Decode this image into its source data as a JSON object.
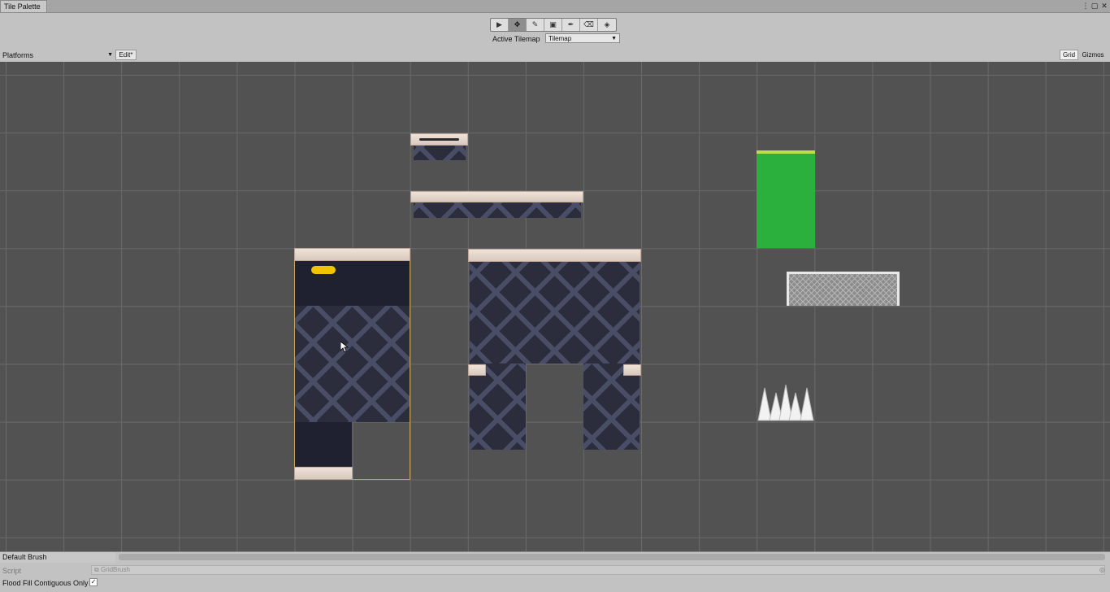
{
  "window": {
    "tab_title": "Tile Palette",
    "menu_icon": "kebab-icon",
    "maximize_icon": "maximize-icon",
    "close_icon": "close-icon"
  },
  "toolbar": {
    "tools": [
      {
        "name": "select-tool",
        "icon": "▶",
        "active": false
      },
      {
        "name": "move-tool",
        "icon": "✥",
        "active": true
      },
      {
        "name": "paint-brush-tool",
        "icon": "✎",
        "active": false
      },
      {
        "name": "box-fill-tool",
        "icon": "▣",
        "active": false
      },
      {
        "name": "picker-tool",
        "icon": "✒",
        "active": false
      },
      {
        "name": "eraser-tool",
        "icon": "⌫",
        "active": false
      },
      {
        "name": "fill-bucket-tool",
        "icon": "◈",
        "active": false
      }
    ],
    "active_tilemap_label": "Active Tilemap",
    "active_tilemap_value": "Tilemap"
  },
  "palette": {
    "selected": "Platforms",
    "edit_label": "Edit*",
    "grid_label": "Grid",
    "gizmos_label": "Gizmos"
  },
  "colors": {
    "grid_bg": "#525252",
    "grass": "#2bb03d",
    "frame": "#2b2d3d",
    "cap": "#efe2d8",
    "selection": "#c8a85a"
  },
  "brush": {
    "selected": "Default Brush",
    "script_label": "Script",
    "script_value": "GridBrush",
    "flood_fill_label": "Flood Fill Contiguous Only",
    "flood_fill_checked": true
  }
}
